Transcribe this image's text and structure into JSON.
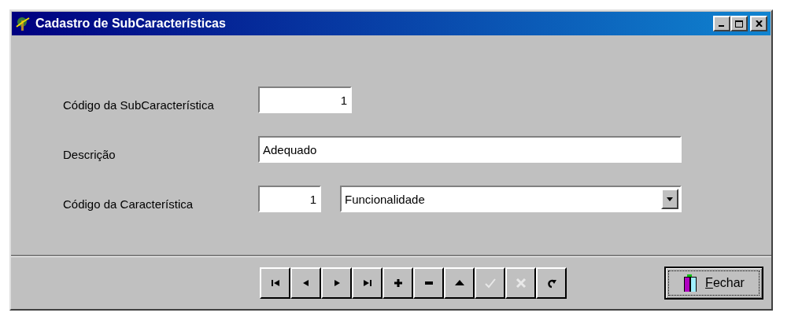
{
  "window": {
    "title": "Cadastro de SubCaracterísticas"
  },
  "fields": [
    {
      "label": "Código da SubCaracterística",
      "value": "1"
    },
    {
      "label": "Descrição",
      "value": "Adequado"
    },
    {
      "label": "Código da Característica",
      "value": "1",
      "dropdown_value": "Funcionalidade"
    }
  ],
  "navigator": [
    {
      "kind": "first",
      "disabled": false
    },
    {
      "kind": "prior",
      "disabled": false
    },
    {
      "kind": "next",
      "disabled": false
    },
    {
      "kind": "last",
      "disabled": false
    },
    {
      "kind": "insert",
      "disabled": false
    },
    {
      "kind": "delete",
      "disabled": false
    },
    {
      "kind": "edit",
      "disabled": false
    },
    {
      "kind": "post",
      "disabled": true
    },
    {
      "kind": "cancel",
      "disabled": true
    },
    {
      "kind": "refresh",
      "disabled": false
    }
  ],
  "close_button": {
    "label": "Fechar"
  }
}
